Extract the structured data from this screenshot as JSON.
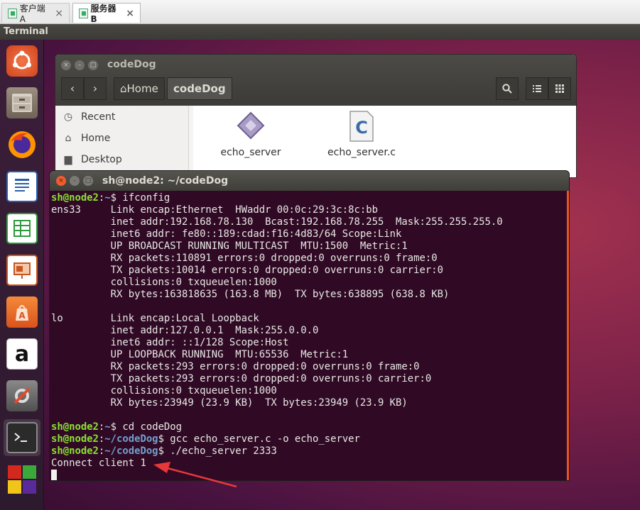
{
  "vm_tabs": [
    {
      "label": "客户端A",
      "active": false
    },
    {
      "label": "服务器B",
      "active": true
    }
  ],
  "top_panel": {
    "title": "Terminal"
  },
  "launcher": {
    "items": [
      "ubuntu-dash-icon",
      "files-icon",
      "firefox-icon",
      "writer-icon",
      "calc-icon",
      "impress-icon",
      "software-center-icon",
      "amazon-icon",
      "system-settings-icon",
      "terminal-icon",
      "workspaces-icon"
    ],
    "amazon_letter": "a"
  },
  "file_manager": {
    "title": "codeDog",
    "breadcrumb": {
      "home": "Home",
      "current": "codeDog"
    },
    "sidebar": [
      {
        "label": "Recent",
        "icon": "clock-icon"
      },
      {
        "label": "Home",
        "icon": "home-icon"
      },
      {
        "label": "Desktop",
        "icon": "folder-icon"
      }
    ],
    "files": [
      {
        "name": "echo_server",
        "icon": "executable-icon"
      },
      {
        "name": "echo_server.c",
        "icon": "c-source-icon"
      }
    ]
  },
  "terminal": {
    "title": "sh@node2: ~/codeDog",
    "prompt_user": "sh@node2",
    "lines": [
      {
        "type": "prompt",
        "path": "~",
        "cmd": " ifconfig"
      },
      {
        "type": "out",
        "text": "ens33     Link encap:Ethernet  HWaddr 00:0c:29:3c:8c:bb"
      },
      {
        "type": "out",
        "text": "          inet addr:192.168.78.130  Bcast:192.168.78.255  Mask:255.255.255.0"
      },
      {
        "type": "out",
        "text": "          inet6 addr: fe80::189:cdad:f16:4d83/64 Scope:Link"
      },
      {
        "type": "out",
        "text": "          UP BROADCAST RUNNING MULTICAST  MTU:1500  Metric:1"
      },
      {
        "type": "out",
        "text": "          RX packets:110891 errors:0 dropped:0 overruns:0 frame:0"
      },
      {
        "type": "out",
        "text": "          TX packets:10014 errors:0 dropped:0 overruns:0 carrier:0"
      },
      {
        "type": "out",
        "text": "          collisions:0 txqueuelen:1000"
      },
      {
        "type": "out",
        "text": "          RX bytes:163818635 (163.8 MB)  TX bytes:638895 (638.8 KB)"
      },
      {
        "type": "out",
        "text": ""
      },
      {
        "type": "out",
        "text": "lo        Link encap:Local Loopback"
      },
      {
        "type": "out",
        "text": "          inet addr:127.0.0.1  Mask:255.0.0.0"
      },
      {
        "type": "out",
        "text": "          inet6 addr: ::1/128 Scope:Host"
      },
      {
        "type": "out",
        "text": "          UP LOOPBACK RUNNING  MTU:65536  Metric:1"
      },
      {
        "type": "out",
        "text": "          RX packets:293 errors:0 dropped:0 overruns:0 frame:0"
      },
      {
        "type": "out",
        "text": "          TX packets:293 errors:0 dropped:0 overruns:0 carrier:0"
      },
      {
        "type": "out",
        "text": "          collisions:0 txqueuelen:1000"
      },
      {
        "type": "out",
        "text": "          RX bytes:23949 (23.9 KB)  TX bytes:23949 (23.9 KB)"
      },
      {
        "type": "out",
        "text": ""
      },
      {
        "type": "prompt",
        "path": "~",
        "cmd": " cd codeDog"
      },
      {
        "type": "prompt",
        "path": "~/codeDog",
        "cmd": " gcc echo_server.c -o echo_server"
      },
      {
        "type": "prompt",
        "path": "~/codeDog",
        "cmd": " ./echo_server 2333"
      },
      {
        "type": "out",
        "text": "Connect client 1"
      },
      {
        "type": "cursor"
      }
    ]
  },
  "colors": {
    "terminal_bg": "#300a24",
    "prompt_user": "#8ae234",
    "prompt_path": "#729fcf",
    "arrow": "#e8393a"
  }
}
